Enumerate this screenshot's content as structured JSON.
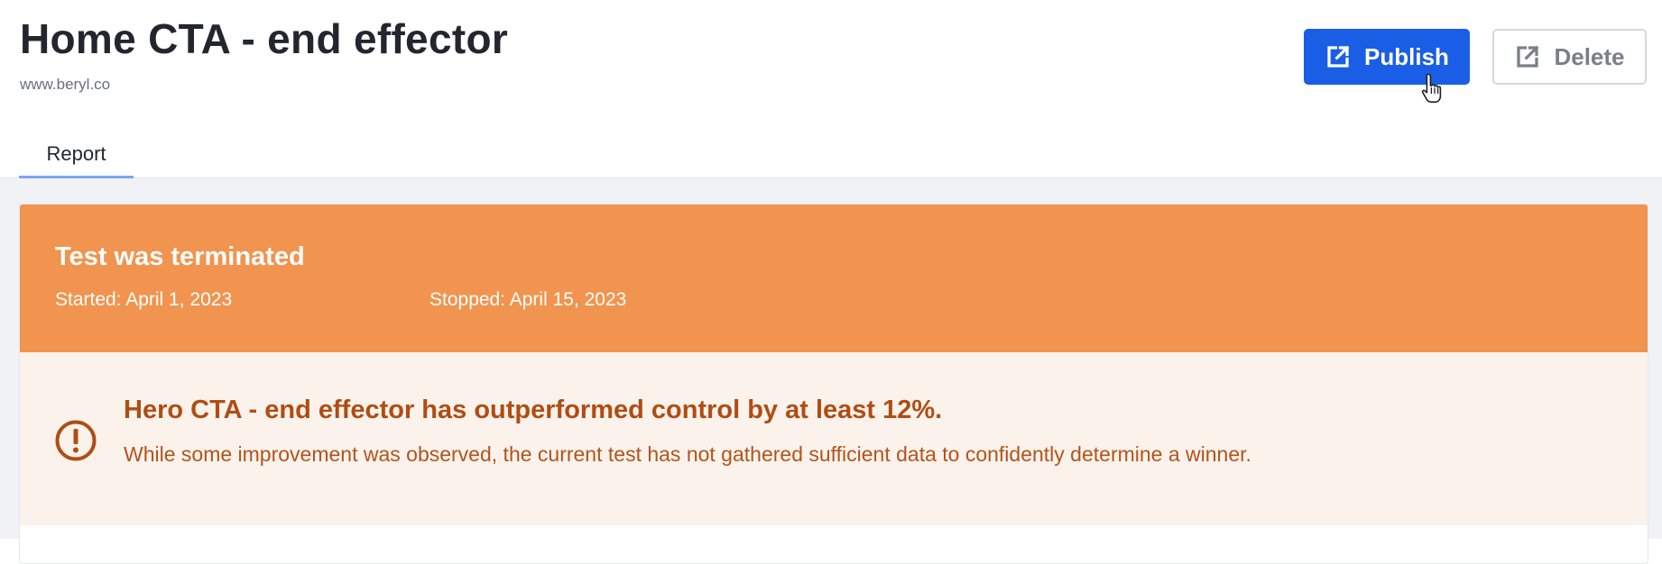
{
  "header": {
    "title": "Home CTA - end effector",
    "url": "www.beryl.co",
    "actions": {
      "publish_label": "Publish",
      "delete_label": "Delete",
      "publish_icon": "external-link-icon",
      "delete_icon": "external-link-icon"
    }
  },
  "tabs": [
    {
      "label": "Report",
      "active": true
    }
  ],
  "status_banner": {
    "title": "Test was terminated",
    "started": "Started: April 1, 2023",
    "stopped": "Stopped: April 15, 2023",
    "color": "#f1944f"
  },
  "result_notice": {
    "icon": "alert-circle-icon",
    "title": "Hero CTA - end effector has outperformed control by at least 12%.",
    "body": "While some improvement was observed, the current test has not gathered sufficient data to confidently determine a winner.",
    "color": "#b04d13"
  },
  "colors": {
    "primary": "#1a5ee6",
    "tab_underline": "#7ea3f2",
    "notice_bg": "#fbf2ec"
  }
}
